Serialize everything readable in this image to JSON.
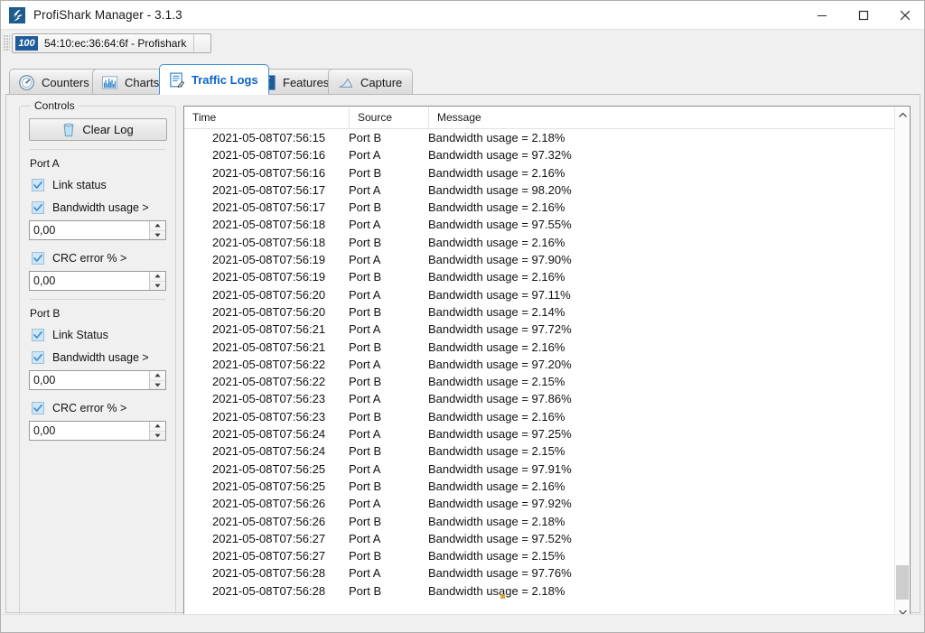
{
  "window": {
    "title": "ProfiShark Manager - 3.1.3",
    "app_icon": "profishark-logo-icon",
    "minimize_label": "Minimize",
    "maximize_label": "Maximize",
    "close_label": "Close"
  },
  "device_bar": {
    "speed_badge": "100",
    "device_label": "54:10:ec:36:64:6f - Profishark"
  },
  "tabs": [
    {
      "label": "Counters",
      "icon": "gauge-icon",
      "active": false
    },
    {
      "label": "Charts",
      "icon": "bar-chart-icon",
      "active": false
    },
    {
      "label": "Traffic Logs",
      "icon": "log-document-icon",
      "active": true
    },
    {
      "label": "Features",
      "icon": "profishark-icon",
      "active": false
    },
    {
      "label": "Capture",
      "icon": "shark-fin-icon",
      "active": false
    }
  ],
  "controls": {
    "group_title": "Controls",
    "clear_log_label": "Clear Log",
    "clear_log_icon": "trash-bin-icon",
    "ports": [
      {
        "title": "Port A",
        "link_status_label": "Link status",
        "link_status_checked": true,
        "bandwidth_label": "Bandwidth usage >",
        "bandwidth_checked": true,
        "bandwidth_value": "0,00",
        "crc_label": "CRC error % >",
        "crc_checked": true,
        "crc_value": "0,00"
      },
      {
        "title": "Port B",
        "link_status_label": "Link Status",
        "link_status_checked": true,
        "bandwidth_label": "Bandwidth usage >",
        "bandwidth_checked": true,
        "bandwidth_value": "0,00",
        "crc_label": "CRC error % >",
        "crc_checked": true,
        "crc_value": "0,00"
      }
    ]
  },
  "log": {
    "columns": [
      "Time",
      "Source",
      "Message"
    ],
    "rows": [
      {
        "time": "2021-05-08T07:56:15",
        "source": "Port B",
        "message": "Bandwidth usage = 2.18%"
      },
      {
        "time": "2021-05-08T07:56:16",
        "source": "Port A",
        "message": "Bandwidth usage = 97.32%"
      },
      {
        "time": "2021-05-08T07:56:16",
        "source": "Port B",
        "message": "Bandwidth usage = 2.16%"
      },
      {
        "time": "2021-05-08T07:56:17",
        "source": "Port A",
        "message": "Bandwidth usage = 98.20%"
      },
      {
        "time": "2021-05-08T07:56:17",
        "source": "Port B",
        "message": "Bandwidth usage = 2.16%"
      },
      {
        "time": "2021-05-08T07:56:18",
        "source": "Port A",
        "message": "Bandwidth usage = 97.55%"
      },
      {
        "time": "2021-05-08T07:56:18",
        "source": "Port B",
        "message": "Bandwidth usage = 2.16%"
      },
      {
        "time": "2021-05-08T07:56:19",
        "source": "Port A",
        "message": "Bandwidth usage = 97.90%"
      },
      {
        "time": "2021-05-08T07:56:19",
        "source": "Port B",
        "message": "Bandwidth usage = 2.16%"
      },
      {
        "time": "2021-05-08T07:56:20",
        "source": "Port A",
        "message": "Bandwidth usage = 97.11%"
      },
      {
        "time": "2021-05-08T07:56:20",
        "source": "Port B",
        "message": "Bandwidth usage = 2.14%"
      },
      {
        "time": "2021-05-08T07:56:21",
        "source": "Port A",
        "message": "Bandwidth usage = 97.72%"
      },
      {
        "time": "2021-05-08T07:56:21",
        "source": "Port B",
        "message": "Bandwidth usage = 2.16%"
      },
      {
        "time": "2021-05-08T07:56:22",
        "source": "Port A",
        "message": "Bandwidth usage = 97.20%"
      },
      {
        "time": "2021-05-08T07:56:22",
        "source": "Port B",
        "message": "Bandwidth usage = 2.15%"
      },
      {
        "time": "2021-05-08T07:56:23",
        "source": "Port A",
        "message": "Bandwidth usage = 97.86%"
      },
      {
        "time": "2021-05-08T07:56:23",
        "source": "Port B",
        "message": "Bandwidth usage = 2.16%"
      },
      {
        "time": "2021-05-08T07:56:24",
        "source": "Port A",
        "message": "Bandwidth usage = 97.25%"
      },
      {
        "time": "2021-05-08T07:56:24",
        "source": "Port B",
        "message": "Bandwidth usage = 2.15%"
      },
      {
        "time": "2021-05-08T07:56:25",
        "source": "Port A",
        "message": "Bandwidth usage = 97.91%"
      },
      {
        "time": "2021-05-08T07:56:25",
        "source": "Port B",
        "message": "Bandwidth usage = 2.16%"
      },
      {
        "time": "2021-05-08T07:56:26",
        "source": "Port A",
        "message": "Bandwidth usage = 97.92%"
      },
      {
        "time": "2021-05-08T07:56:26",
        "source": "Port B",
        "message": "Bandwidth usage = 2.18%"
      },
      {
        "time": "2021-05-08T07:56:27",
        "source": "Port A",
        "message": "Bandwidth usage = 97.52%"
      },
      {
        "time": "2021-05-08T07:56:27",
        "source": "Port B",
        "message": "Bandwidth usage = 2.15%"
      },
      {
        "time": "2021-05-08T07:56:28",
        "source": "Port A",
        "message": "Bandwidth usage = 97.76%"
      },
      {
        "time": "2021-05-08T07:56:28",
        "source": "Port B",
        "message": "Bandwidth usage = 2.18%"
      }
    ]
  },
  "scrollbar": {
    "up_icon": "chevron-up-icon",
    "down_icon": "chevron-down-icon",
    "thumb_top_pct": 92,
    "thumb_height_pct": 7
  },
  "colors": {
    "accent": "#0d63c6",
    "tab_active_border": "#3c8ddb",
    "badge_blue": "#1f5c99",
    "checkbox_fill": "#cfe6f8",
    "window_bg": "#f0f0f0"
  }
}
